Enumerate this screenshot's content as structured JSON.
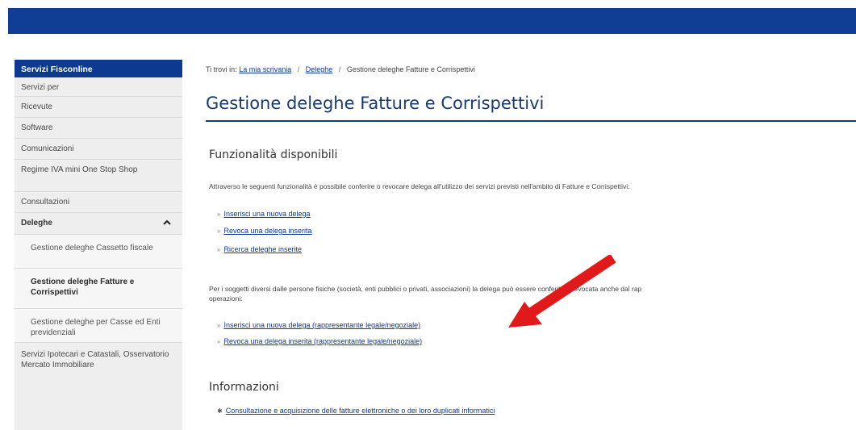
{
  "sidebar": {
    "header": "Servizi Fisconline",
    "items": [
      "Servizi per",
      "Ricevute",
      "Software",
      "Comunicazioni",
      "Regime IVA mini One Stop Shop",
      "Consultazioni"
    ],
    "deleghe": "Deleghe",
    "sub_items": [
      "Gestione deleghe Cassetto fiscale",
      "Gestione deleghe Fatture e Corrispettivi",
      "Gestione deleghe per Casse ed Enti previdenziali"
    ],
    "last_item": "Servizi Ipotecari e Catastali, Osservatorio Mercato Immobiliare"
  },
  "breadcrumb": {
    "prefix": "Ti trovi in:",
    "link1": "La mia scrivania",
    "link2": "Deleghe",
    "current": "Gestione deleghe Fatture e Corrispettivi",
    "separator": "/"
  },
  "main": {
    "title": "Gestione deleghe Fatture e Corrispettivi",
    "funzionalita": {
      "title": "Funzionalità disponibili",
      "intro": "Attraverso le seguenti funzionalità è possibile conferire o revocare delega all'utilizzo dei servizi previsti nell'ambito di Fatture e Corrispettivi:",
      "links": [
        "Inserisci una nuova delega",
        "Revoca una delega inserita",
        "Ricerca deleghe inserite"
      ],
      "para2_line1": "Per i soggetti diversi dalle persone fisiche (società, enti pubblici o privati, associazioni) la delega può essere conferita o revocata anche dal rap",
      "para2_line2": "operazioni:",
      "links2": [
        "Inserisci una nuova delega (rappresentante legale/negoziale)",
        "Revoca una delega inserita (rappresentante legale/negoziale)"
      ]
    },
    "informazioni": {
      "title": "Informazioni",
      "links": [
        "Consultazione e acquisizione delle fatture elettroniche o dei loro duplicati informatici"
      ]
    }
  },
  "colors": {
    "top_bar": "#0f3e95",
    "sidebar_header": "#0b3a8f",
    "link": "#0b3a8f",
    "title": "#1a3a6b",
    "arrow": "#e01a1a"
  },
  "icons": {
    "chevron": "chevron-up-icon",
    "bullet": "small-arrow-bullet-icon",
    "star_bullet": "star-bullet-icon",
    "annotation": "red-arrow-annotation"
  }
}
